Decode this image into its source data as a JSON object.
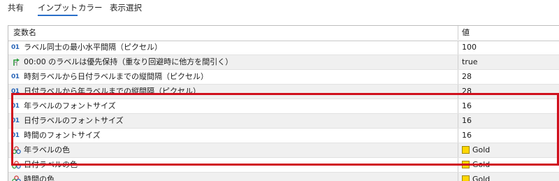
{
  "tabs": [
    {
      "label": "共有",
      "active": false
    },
    {
      "label": "インプット",
      "active": true
    },
    {
      "label": "カラー",
      "active": false
    },
    {
      "label": "表示選択",
      "active": false
    }
  ],
  "table": {
    "headers": {
      "name": "変数名",
      "value": "値"
    },
    "rows": [
      {
        "icon": "01",
        "icon_name": "integer-type-icon",
        "name": "ラベル同士の最小水平間隔（ピクセル）",
        "value": "100"
      },
      {
        "icon": "",
        "icon_name": "boolean-arrow-icon",
        "name": "00:00 のラベルは優先保持（重なり回避時に他方を間引く）",
        "value": "true"
      },
      {
        "icon": "01",
        "icon_name": "integer-type-icon",
        "name": "時刻ラベルから日付ラベルまでの縦間隔（ピクセル）",
        "value": "28"
      },
      {
        "icon": "01",
        "icon_name": "integer-type-icon",
        "name": "日付ラベルから年ラベルまでの縦間隔（ピクセル）",
        "value": "28"
      },
      {
        "icon": "01",
        "icon_name": "integer-type-icon",
        "name": "年ラベルのフォントサイズ",
        "value": "16"
      },
      {
        "icon": "01",
        "icon_name": "integer-type-icon",
        "name": "日付ラベルのフォントサイズ",
        "value": "16"
      },
      {
        "icon": "01",
        "icon_name": "integer-type-icon",
        "name": "時間のフォントサイズ",
        "value": "16"
      },
      {
        "icon": "",
        "icon_name": "color-palette-icon",
        "name": "年ラベルの色",
        "value": "Gold",
        "swatch": "#FFD700"
      },
      {
        "icon": "",
        "icon_name": "color-palette-icon",
        "name": "日付ラベルの色",
        "value": "Gold",
        "swatch": "#FFD700"
      },
      {
        "icon": "",
        "icon_name": "color-palette-icon",
        "name": "時間の色",
        "value": "Gold",
        "swatch": "#FFD700"
      }
    ]
  },
  "colors": {
    "accent_tab_underline": "#2a6fc9",
    "highlight_border": "#d0101d",
    "int_icon": "#2a66b8",
    "bool_icon": "#2e9e3e"
  }
}
